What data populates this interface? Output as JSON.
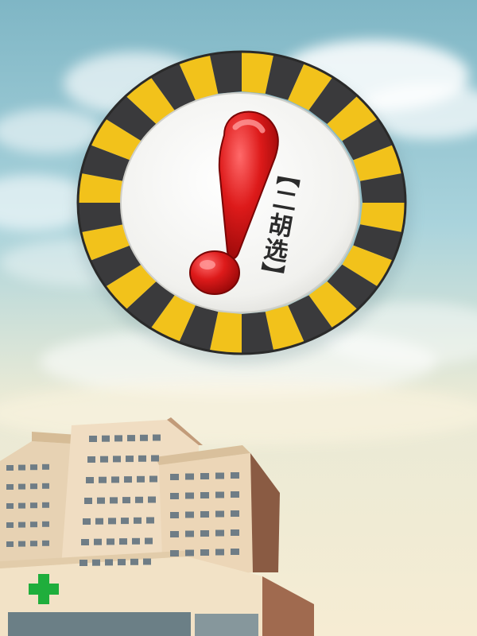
{
  "badge": {
    "label": "【二胡选】"
  },
  "colors": {
    "sky_top": "#7fb7c6",
    "sky_bottom": "#f3e9cf",
    "badge_yellow": "#f2c21b",
    "badge_dark": "#3a3a3c",
    "badge_face": "#f4f4f2",
    "exclamation_red": "#d41414",
    "building_face": "#efdcc0",
    "building_shadow": "#8a5b43",
    "cross_green": "#1fae3c"
  },
  "icons": {
    "exclamation": "exclamation-mark-icon",
    "hospital": "hospital-building-icon",
    "cross": "medical-cross-icon"
  }
}
